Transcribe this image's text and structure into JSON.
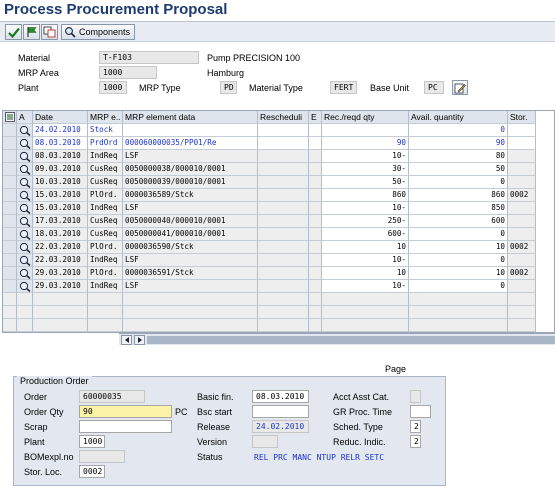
{
  "page": {
    "title": "Process Procurement Proposal"
  },
  "toolbar": {
    "components_label": "Components"
  },
  "header": {
    "material_label": "Material",
    "material_value": "T-F103",
    "material_desc": "Pump PRECISION 100",
    "mrp_area_label": "MRP Area",
    "mrp_area_value": "1000",
    "mrp_area_desc": "Hamburg",
    "plant_label": "Plant",
    "plant_value": "1000",
    "mrp_type_label": "MRP Type",
    "mrp_type_value": "PD",
    "material_type_label": "Material Type",
    "material_type_value": "FERT",
    "base_unit_label": "Base Unit",
    "base_unit_value": "PC"
  },
  "table": {
    "columns": [
      "A",
      "Date",
      "MRP e..",
      "MRP element data",
      "Rescheduli",
      "E",
      "Rec./reqd qty",
      "Avail. quantity",
      "Stor."
    ],
    "rows": [
      {
        "date": "24.02.2010",
        "mrp_e": "Stock",
        "data": "",
        "resched": "",
        "e": "",
        "qty": "",
        "avail": "0",
        "stor": "",
        "blue": true
      },
      {
        "date": "08.03.2010",
        "mrp_e": "PrdOrd",
        "data": "000060000035/PP01/Re",
        "resched": "",
        "e": "",
        "qty": "90",
        "avail": "90",
        "stor": "",
        "blue": true
      },
      {
        "date": "08.03.2010",
        "mrp_e": "IndReq",
        "data": "LSF",
        "resched": "",
        "e": "",
        "qty": "10-",
        "avail": "80",
        "stor": ""
      },
      {
        "date": "09.03.2010",
        "mrp_e": "CusReq",
        "data": "0050000038/000010/0001",
        "resched": "",
        "e": "",
        "qty": "30-",
        "avail": "50",
        "stor": ""
      },
      {
        "date": "10.03.2010",
        "mrp_e": "CusReq",
        "data": "0050000039/000010/0001",
        "resched": "",
        "e": "",
        "qty": "50-",
        "avail": "0",
        "stor": ""
      },
      {
        "date": "15.03.2010",
        "mrp_e": "PlOrd.",
        "data": "0000036589/Stck",
        "resched": "",
        "e": "",
        "qty": "860",
        "avail": "860",
        "stor": "0002"
      },
      {
        "date": "15.03.2010",
        "mrp_e": "IndReq",
        "data": "LSF",
        "resched": "",
        "e": "",
        "qty": "10-",
        "avail": "850",
        "stor": ""
      },
      {
        "date": "17.03.2010",
        "mrp_e": "CusReq",
        "data": "0050000040/000010/0001",
        "resched": "",
        "e": "",
        "qty": "250-",
        "avail": "600",
        "stor": ""
      },
      {
        "date": "18.03.2010",
        "mrp_e": "CusReq",
        "data": "0050000041/000010/0001",
        "resched": "",
        "e": "",
        "qty": "600-",
        "avail": "0",
        "stor": ""
      },
      {
        "date": "22.03.2010",
        "mrp_e": "PlOrd.",
        "data": "0000036590/Stck",
        "resched": "",
        "e": "",
        "qty": "10",
        "avail": "10",
        "stor": "0002"
      },
      {
        "date": "22.03.2010",
        "mrp_e": "IndReq",
        "data": "LSF",
        "resched": "",
        "e": "",
        "qty": "10-",
        "avail": "0",
        "stor": ""
      },
      {
        "date": "29.03.2010",
        "mrp_e": "PlOrd.",
        "data": "0000036591/Stck",
        "resched": "",
        "e": "",
        "qty": "10",
        "avail": "10",
        "stor": "0002"
      },
      {
        "date": "29.03.2010",
        "mrp_e": "IndReq",
        "data": "LSF",
        "resched": "",
        "e": "",
        "qty": "10-",
        "avail": "0",
        "stor": ""
      }
    ]
  },
  "page_label": "Page",
  "production_order": {
    "title": "Production Order",
    "order_label": "Order",
    "order_value": "60000035",
    "order_qty_label": "Order Qty",
    "order_qty_value": "90",
    "order_qty_unit": "PC",
    "scrap_label": "Scrap",
    "scrap_value": "",
    "plant_label": "Plant",
    "plant_value": "1000",
    "bomexpl_label": "BOMexpl.no",
    "bomexpl_value": "",
    "stor_loc_label": "Stor. Loc.",
    "stor_loc_value": "0002",
    "basic_fin_label": "Basic fin.",
    "basic_fin_value": "08.03.2010",
    "bsc_start_label": "Bsc start",
    "bsc_start_value": "",
    "release_label": "Release",
    "release_value": "24.02.2010",
    "version_label": "Version",
    "version_value": "",
    "status_label": "Status",
    "status_value": "REL  PRC  MANC NTUP RELR SETC",
    "acct_label": "Acct Asst Cat.",
    "acct_value": "",
    "gr_label": "GR Proc. Time",
    "gr_value": "",
    "sched_label": "Sched. Type",
    "sched_value": "2",
    "reduc_label": "Reduc. Indic.",
    "reduc_value": "2"
  }
}
